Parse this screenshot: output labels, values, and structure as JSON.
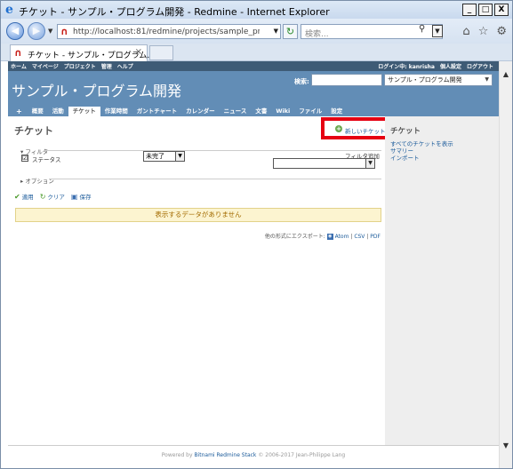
{
  "browser": {
    "title": "チケット - サンプル・プログラム開発 - Redmine - Internet Explorer",
    "title_icon": "e",
    "window_buttons": [
      "_",
      "□",
      "X"
    ],
    "address_url": "http://localhost:81/redmine/projects/sample_pro",
    "search_placeholder": "検索...",
    "tab_title": "チケット - サンプル・プログラム...",
    "tab_close": "×",
    "colors": {
      "frame": "#7a8ea8",
      "chrome": "#dfe8f4"
    }
  },
  "redmine": {
    "top_menu": {
      "left": [
        "ホーム",
        "マイページ",
        "プロジェクト",
        "管理",
        "ヘルプ"
      ],
      "right": [
        "ログイン中: kanrisha",
        "個人設定",
        "ログアウト"
      ]
    },
    "header": {
      "project_title": "サンプル・プログラム開発",
      "search_label": "検索:",
      "search_value": "",
      "project_select": "サンプル・プログラム開発"
    },
    "main_menu": [
      {
        "label": "+"
      },
      {
        "label": "概要"
      },
      {
        "label": "活動"
      },
      {
        "label": "チケット"
      },
      {
        "label": "作業時間"
      },
      {
        "label": "ガントチャート"
      },
      {
        "label": "カレンダー"
      },
      {
        "label": "ニュース"
      },
      {
        "label": "文書"
      },
      {
        "label": "Wiki"
      },
      {
        "label": "ファイル"
      },
      {
        "label": "設定"
      }
    ],
    "content": {
      "heading": "チケット",
      "new_issue": "新しいチケット",
      "filters_legend": "フィルタ",
      "status_label": "ステータス",
      "status_checked": "☑",
      "status_value": "未完了",
      "add_filter_label": "フィルタ追加",
      "options_legend": "オプション",
      "actions": [
        {
          "label": "適用",
          "icon": "check-icon"
        },
        {
          "label": "クリア",
          "icon": "reload-icon"
        },
        {
          "label": "保存",
          "icon": "save-icon"
        }
      ],
      "no_data": "表示するデータがありません",
      "export_prefix": "他の形式にエクスポート:",
      "export_atom": "Atom",
      "export_csv": "CSV",
      "export_pdf": "PDF",
      "export_sep": "|"
    },
    "sidebar": {
      "title": "チケット",
      "links": [
        "すべてのチケットを表示",
        "サマリー",
        "インポート"
      ]
    },
    "footer": {
      "prefix": "Powered by",
      "link": "Bitnami Redmine Stack",
      "suffix": "© 2006-2017 Jean-Philippe Lang"
    },
    "colors": {
      "header": "#628db6",
      "top_menu": "#3e5b76",
      "highlight_box": "#e60012",
      "link": "#1a5a9a",
      "nodata_bg": "#fcf4d0"
    }
  }
}
